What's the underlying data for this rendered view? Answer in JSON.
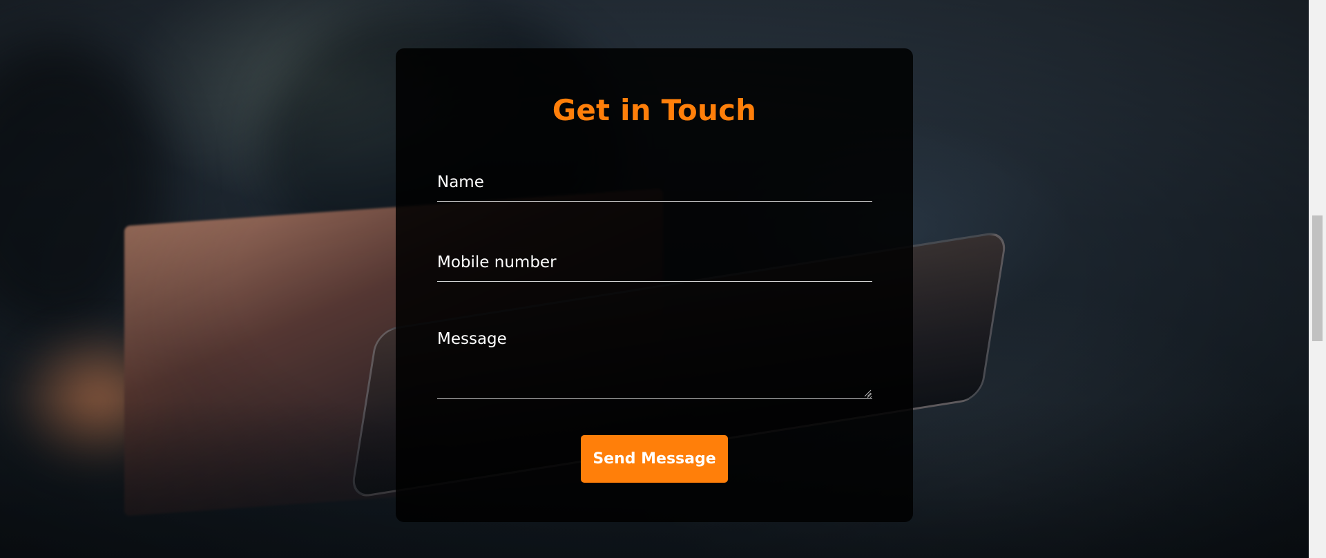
{
  "contact_form": {
    "title": "Get in Touch",
    "name_placeholder": "Name",
    "mobile_placeholder": "Mobile number",
    "message_placeholder": "Message",
    "submit_label": "Send Message"
  },
  "colors": {
    "accent": "#ff7f0a",
    "card_background": "#000000",
    "text": "#ffffff"
  }
}
